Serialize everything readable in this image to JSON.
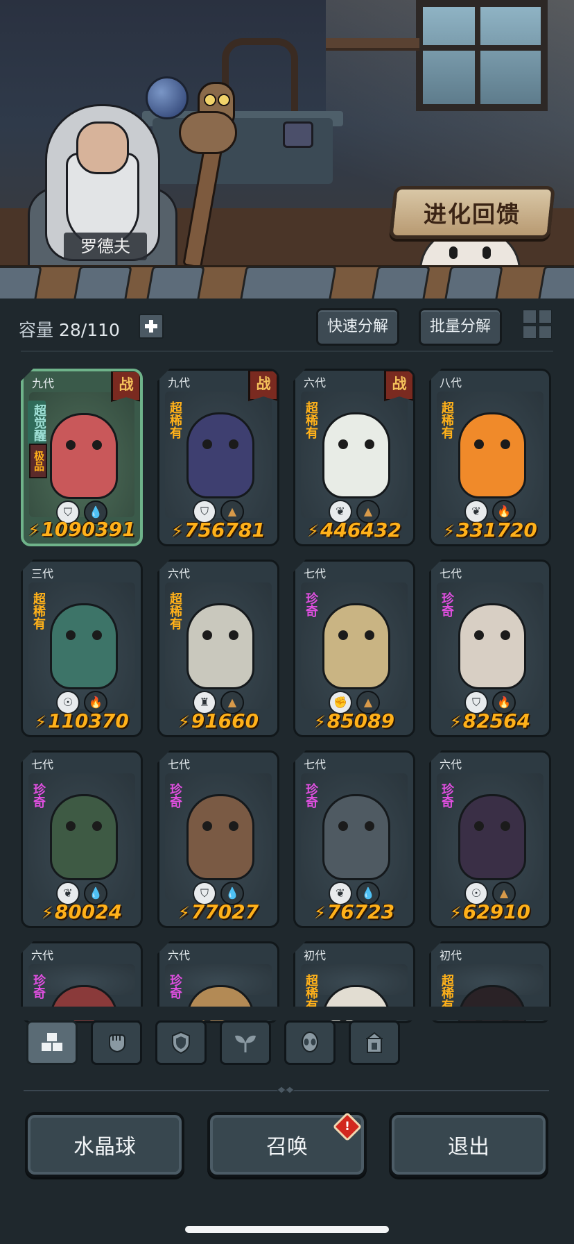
{
  "scene": {
    "npc_name": "罗德夫",
    "evolve_feedback_label": "进化回馈"
  },
  "toolbar": {
    "capacity_label": "容量",
    "capacity_value": "28/110",
    "quick_decompose": "快速分解",
    "batch_decompose": "批量分解"
  },
  "cards": [
    {
      "gen": "九代",
      "rarity": "超觉醒",
      "rarity_kind": "awake",
      "tag": "极品",
      "battle": "战",
      "selected": true,
      "power": "1090391",
      "icon_class": "shield-icon",
      "icon_glyph": "⛉",
      "element": "water",
      "element_glyph": "💧",
      "element_color": "#5fc6ea",
      "creature_color": "#c9585a"
    },
    {
      "gen": "九代",
      "rarity": "超稀有",
      "rarity_kind": "rare",
      "tag": "",
      "battle": "战",
      "selected": false,
      "power": "756781",
      "icon_class": "shield-icon",
      "icon_glyph": "⛉",
      "element": "earth",
      "element_glyph": "▲",
      "element_color": "#d89a4a",
      "creature_color": "#3e3f70"
    },
    {
      "gen": "六代",
      "rarity": "超稀有",
      "rarity_kind": "rare",
      "tag": "",
      "battle": "战",
      "selected": false,
      "power": "446432",
      "icon_class": "sprout-icon",
      "icon_glyph": "❦",
      "element": "earth",
      "element_glyph": "▲",
      "element_color": "#d89a4a",
      "creature_color": "#e8ece6"
    },
    {
      "gen": "八代",
      "rarity": "超稀有",
      "rarity_kind": "rare",
      "tag": "",
      "battle": "",
      "selected": false,
      "power": "331720",
      "icon_class": "sprout-icon",
      "icon_glyph": "❦",
      "element": "fire",
      "element_glyph": "🔥",
      "element_color": "#e2463a",
      "creature_color": "#f08a2a"
    },
    {
      "gen": "三代",
      "rarity": "超稀有",
      "rarity_kind": "rare",
      "tag": "",
      "battle": "",
      "selected": false,
      "power": "110370",
      "icon_class": "alien-icon",
      "icon_glyph": "☉",
      "element": "fire",
      "element_glyph": "🔥",
      "element_color": "#e2463a",
      "creature_color": "#3d7468"
    },
    {
      "gen": "六代",
      "rarity": "超稀有",
      "rarity_kind": "rare",
      "tag": "",
      "battle": "",
      "selected": false,
      "power": "91660",
      "icon_class": "tower-icon",
      "icon_glyph": "♜",
      "element": "earth",
      "element_glyph": "▲",
      "element_color": "#d89a4a",
      "creature_color": "#c9c8bd"
    },
    {
      "gen": "七代",
      "rarity": "珍奇",
      "rarity_kind": "epic",
      "tag": "",
      "battle": "",
      "selected": false,
      "power": "85089",
      "icon_class": "fist-icon",
      "icon_glyph": "✊",
      "element": "earth",
      "element_glyph": "▲",
      "element_color": "#d89a4a",
      "creature_color": "#c9b483"
    },
    {
      "gen": "七代",
      "rarity": "珍奇",
      "rarity_kind": "epic",
      "tag": "",
      "battle": "",
      "selected": false,
      "power": "82564",
      "icon_class": "shield-icon",
      "icon_glyph": "⛉",
      "element": "fire",
      "element_glyph": "🔥",
      "element_color": "#e2463a",
      "creature_color": "#d8cfc4"
    },
    {
      "gen": "七代",
      "rarity": "珍奇",
      "rarity_kind": "epic",
      "tag": "",
      "battle": "",
      "selected": false,
      "power": "80024",
      "icon_class": "sprout-icon",
      "icon_glyph": "❦",
      "element": "water",
      "element_glyph": "💧",
      "element_color": "#5fc6ea",
      "creature_color": "#3e5a44"
    },
    {
      "gen": "七代",
      "rarity": "珍奇",
      "rarity_kind": "epic",
      "tag": "",
      "battle": "",
      "selected": false,
      "power": "77027",
      "icon_class": "shield-icon",
      "icon_glyph": "⛉",
      "element": "water",
      "element_glyph": "💧",
      "element_color": "#5fc6ea",
      "creature_color": "#7a5a44"
    },
    {
      "gen": "七代",
      "rarity": "珍奇",
      "rarity_kind": "epic",
      "tag": "",
      "battle": "",
      "selected": false,
      "power": "76723",
      "icon_class": "sprout-icon",
      "icon_glyph": "❦",
      "element": "water",
      "element_glyph": "💧",
      "element_color": "#5fc6ea",
      "creature_color": "#4f5a62"
    },
    {
      "gen": "六代",
      "rarity": "珍奇",
      "rarity_kind": "epic",
      "tag": "",
      "battle": "",
      "selected": false,
      "power": "62910",
      "icon_class": "alien-icon",
      "icon_glyph": "☉",
      "element": "earth",
      "element_glyph": "▲",
      "element_color": "#d89a4a",
      "creature_color": "#3a2f46"
    },
    {
      "gen": "六代",
      "rarity": "珍奇",
      "rarity_kind": "epic",
      "tag": "",
      "battle": "",
      "selected": false,
      "power": "",
      "icon_class": "",
      "icon_glyph": "",
      "element": "",
      "element_glyph": "",
      "element_color": "",
      "creature_color": "#8a3a3a"
    },
    {
      "gen": "六代",
      "rarity": "珍奇",
      "rarity_kind": "epic",
      "tag": "",
      "battle": "",
      "selected": false,
      "power": "",
      "icon_class": "",
      "icon_glyph": "",
      "element": "",
      "element_glyph": "",
      "element_color": "",
      "creature_color": "#b38a55"
    },
    {
      "gen": "初代",
      "rarity": "超稀有",
      "rarity_kind": "rare",
      "tag": "",
      "battle": "",
      "selected": false,
      "power": "",
      "icon_class": "",
      "icon_glyph": "",
      "element": "",
      "element_glyph": "",
      "element_color": "",
      "creature_color": "#e2ddd2"
    },
    {
      "gen": "初代",
      "rarity": "超稀有",
      "rarity_kind": "rare",
      "tag": "",
      "battle": "",
      "selected": false,
      "power": "",
      "icon_class": "",
      "icon_glyph": "",
      "element": "",
      "element_glyph": "",
      "element_color": "",
      "creature_color": "#2a2226"
    }
  ],
  "filter_tabs": [
    {
      "icon": "all-icon",
      "active": true
    },
    {
      "icon": "fist-icon",
      "active": false
    },
    {
      "icon": "shield-icon",
      "active": false
    },
    {
      "icon": "sprout-icon",
      "active": false
    },
    {
      "icon": "alien-icon",
      "active": false
    },
    {
      "icon": "tower-icon",
      "active": false
    }
  ],
  "bottom": {
    "crystal_ball": "水晶球",
    "summon": "召唤",
    "summon_alert": "!",
    "exit": "退出"
  },
  "colors": {
    "accent_gold": "#ffb11a",
    "rarity_epic": "#e04fe0",
    "selected_border": "#6fb38a"
  }
}
